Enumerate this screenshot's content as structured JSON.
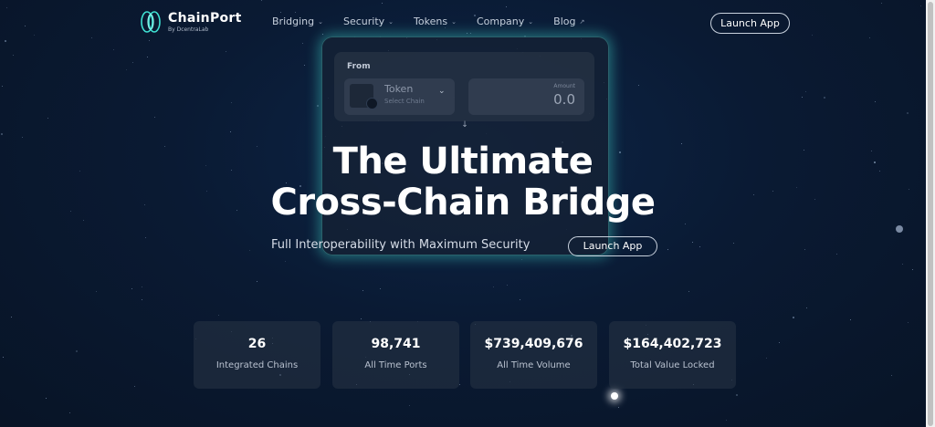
{
  "brand": {
    "name": "ChainPort",
    "tagline": "By DcentraLab"
  },
  "nav": {
    "items": [
      {
        "label": "Bridging",
        "icon": "chevron-down-icon"
      },
      {
        "label": "Security",
        "icon": "chevron-down-icon"
      },
      {
        "label": "Tokens",
        "icon": "chevron-down-icon"
      },
      {
        "label": "Company",
        "icon": "chevron-down-icon"
      },
      {
        "label": "Blog",
        "icon": "external-arrow-icon"
      }
    ],
    "launch_label": "Launch App"
  },
  "widget": {
    "from_label": "From",
    "token_name": "Token",
    "token_sub": "Select Chain",
    "amount_label": "Amount",
    "amount_value": "0.0"
  },
  "hero": {
    "title_line1": "The Ultimate",
    "title_line2": "Cross-Chain Bridge",
    "subtitle": "Full Interoperability with Maximum Security",
    "launch_label": "Launch App"
  },
  "stats": [
    {
      "value": "26",
      "label": "Integrated Chains"
    },
    {
      "value": "98,741",
      "label": "All Time Ports"
    },
    {
      "value": "$739,409,676",
      "label": "All Time Volume"
    },
    {
      "value": "$164,402,723",
      "label": "Total Value Locked"
    }
  ],
  "colors": {
    "accent_glow": "#40d2c8",
    "background": "#0a1a33"
  }
}
